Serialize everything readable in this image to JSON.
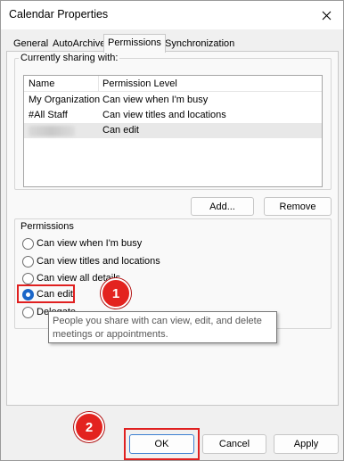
{
  "window": {
    "title": "Calendar Properties"
  },
  "tabs": [
    {
      "label": "General"
    },
    {
      "label": "AutoArchive"
    },
    {
      "label": "Permissions"
    },
    {
      "label": "Synchronization"
    }
  ],
  "sharing": {
    "group_label": "Currently sharing with:",
    "columns": [
      "Name",
      "Permission Level"
    ],
    "rows": [
      {
        "name": "My Organization",
        "level": "Can view when I'm busy"
      },
      {
        "name": "#All Staff",
        "level": "Can view titles and locations"
      },
      {
        "name": "",
        "level": "Can edit",
        "selected": true
      }
    ],
    "add_button": "Add...",
    "remove_button": "Remove"
  },
  "permissions": {
    "group_label": "Permissions",
    "options": [
      {
        "label": "Can view when I'm busy",
        "checked": false
      },
      {
        "label": "Can view titles and locations",
        "checked": false
      },
      {
        "label": "Can view all details",
        "checked": false
      },
      {
        "label": "Can edit",
        "checked": true
      },
      {
        "label": "Delegate",
        "checked": false
      }
    ],
    "tooltip": "People you share with can view, edit, and delete meetings or appointments."
  },
  "annotations": {
    "badge1": "1",
    "badge2": "2",
    "highlight_color": "#e02020"
  },
  "footer": {
    "ok": "OK",
    "cancel": "Cancel",
    "apply": "Apply"
  }
}
